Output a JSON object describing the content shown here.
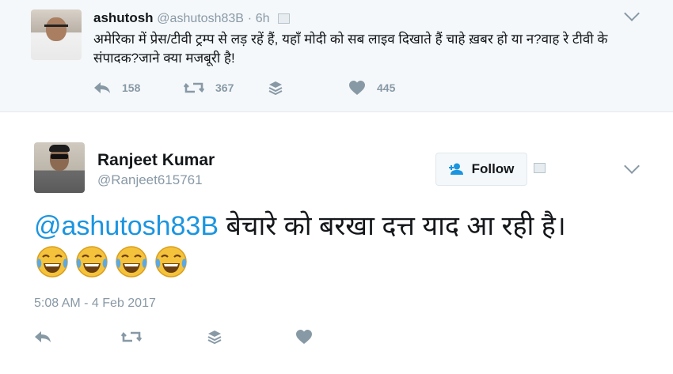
{
  "parent_tweet": {
    "name": "ashutosh",
    "handle": "@ashutosh83B",
    "separator": "·",
    "time": "6h",
    "text": "अमेरिका में प्रेस/टीवी ट्रम्प से लड़ रहें हैं, यहाँ मोदी को सब लाइव दिखाते हैं चाहे ख़बर हो या न?वाह रे टीवी के संपादक?जाने क्या मजबूरी है!",
    "reply_count": "158",
    "retweet_count": "367",
    "like_count": "445"
  },
  "main_tweet": {
    "name": "Ranjeet Kumar",
    "handle": "@Ranjeet615761",
    "follow_label": "Follow",
    "mention": "@ashutosh83B",
    "text": " बेचारे को बरखा दत्त याद आ रही है।",
    "emojis": [
      "😂",
      "😂",
      "😂",
      "😂"
    ],
    "timestamp": "5:08 AM - 4 Feb 2017"
  },
  "icons": {
    "reply": "reply-icon",
    "retweet": "retweet-icon",
    "moments": "layers-icon",
    "like": "heart-icon",
    "more": "chevron-down-icon",
    "follow": "add-user-icon"
  },
  "colors": {
    "mention": "#1b95e0",
    "muted": "#8899a6",
    "parent_bg": "#f5f8fa"
  }
}
